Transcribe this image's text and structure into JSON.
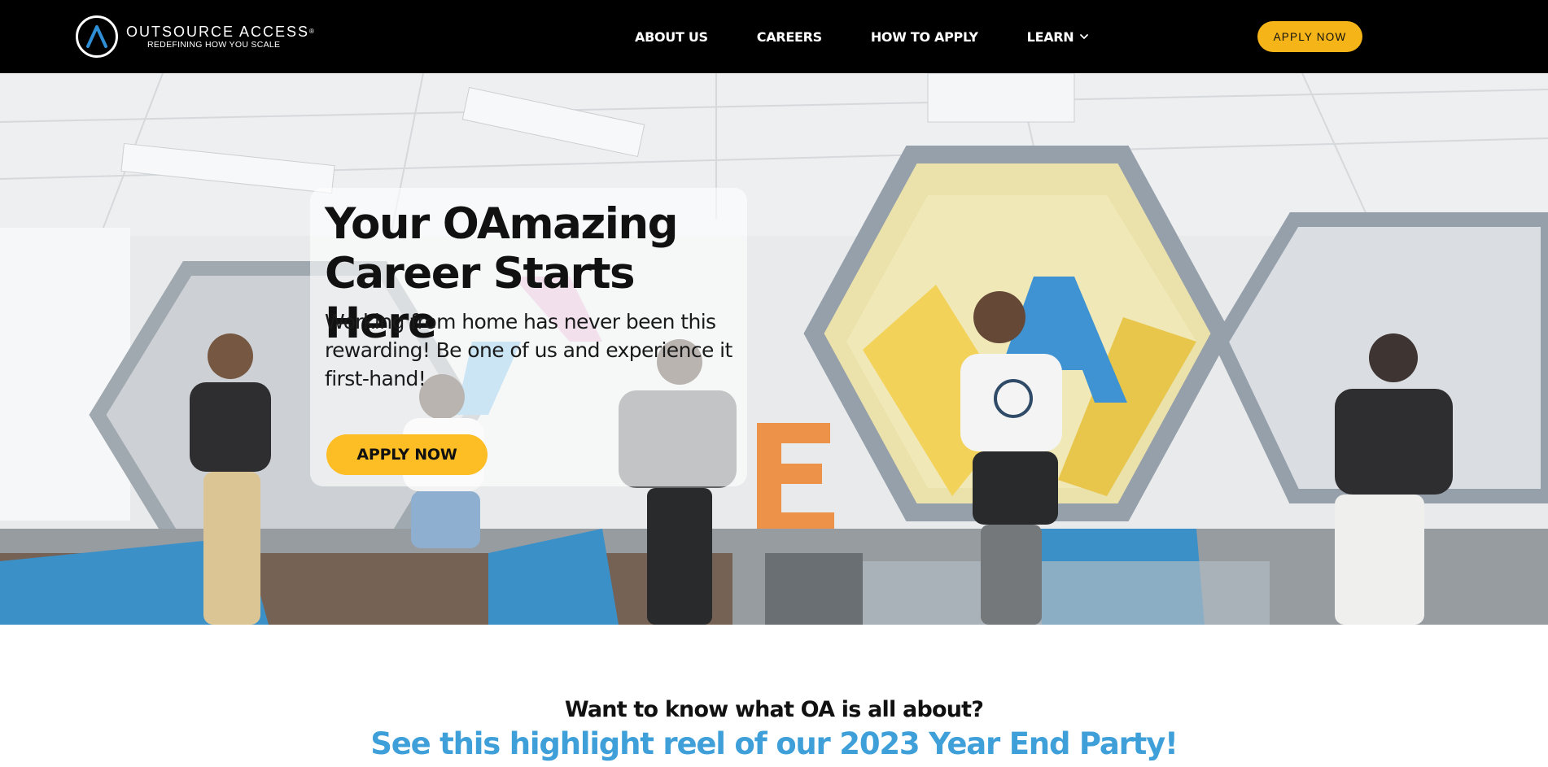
{
  "header": {
    "logo": {
      "name": "OUTSOURCE ACCESS",
      "trademark": "®",
      "tagline": "REDEFINING HOW YOU SCALE",
      "icon": "oa-logo-icon"
    },
    "nav": [
      {
        "label": "ABOUT US"
      },
      {
        "label": "CAREERS"
      },
      {
        "label": "HOW TO APPLY"
      },
      {
        "label": "LEARN",
        "icon": "chevron-down-icon"
      }
    ],
    "apply_button": "APPLY NOW"
  },
  "hero": {
    "title": "Your OAmazing Career Starts Here",
    "subtitle": "Working from home has never been this rewarding! Be one of us and experience it first-hand!",
    "apply_button": "APPLY NOW"
  },
  "highlight": {
    "question": "Want to know what OA is all about?",
    "headline": "See this highlight reel of our 2023 Year End Party!"
  },
  "colors": {
    "header_bg": "#000000",
    "accent_yellow": "#f5b417",
    "headline_blue": "#3fa0d9"
  }
}
